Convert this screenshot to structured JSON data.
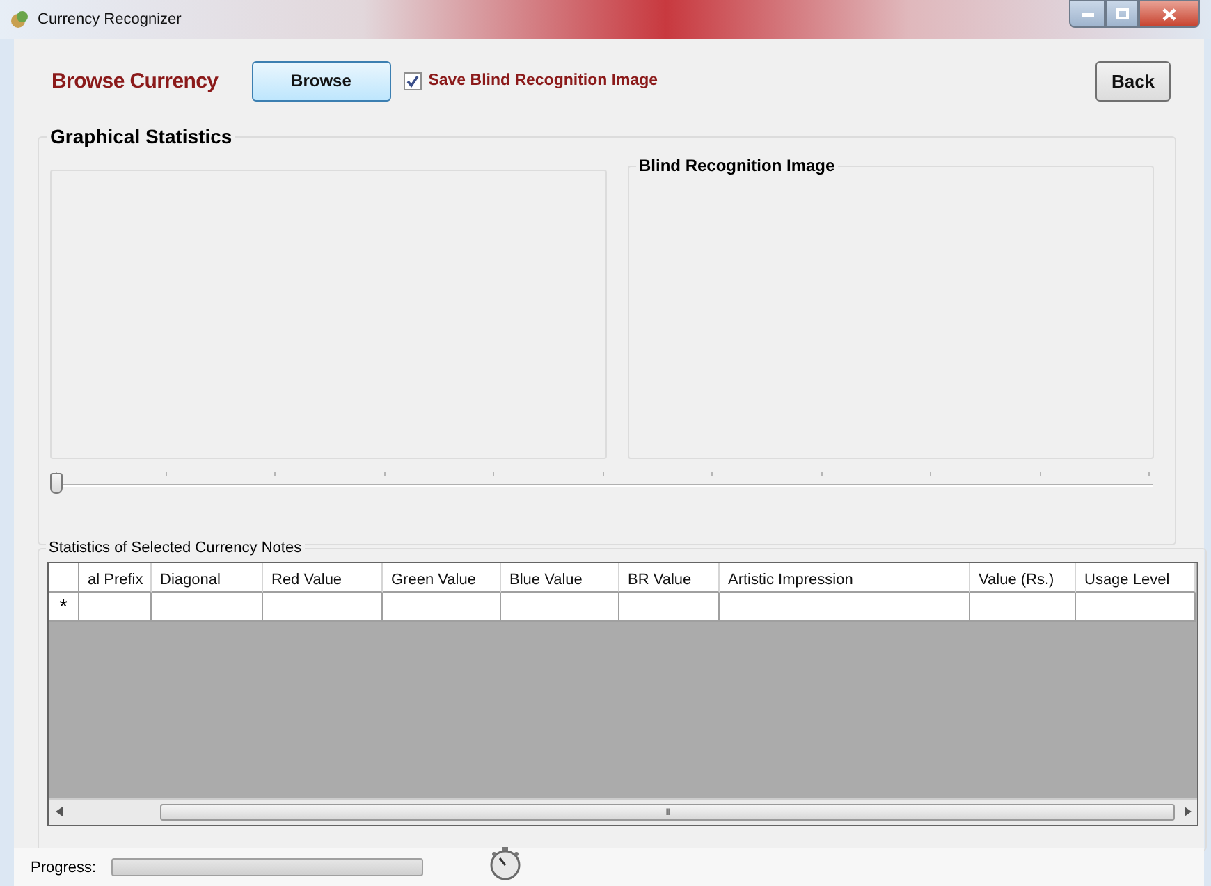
{
  "window": {
    "title": "Currency Recognizer"
  },
  "toolbar": {
    "label": "Browse Currency",
    "browse_button": "Browse",
    "save_checkbox": {
      "label": "Save Blind Recognition Image",
      "checked": true
    },
    "back_button": "Back"
  },
  "graphical_statistics": {
    "title": "Graphical Statistics",
    "image_group": {
      "title": "Blind Recognition Image"
    },
    "slider": {
      "level": 0
    }
  },
  "statistics": {
    "title": "Statistics of Selected Currency Notes",
    "columns": [
      "al Prefix",
      "Diagonal",
      "Red Value",
      "Green Value",
      "Blue Value",
      "BR Value",
      "Artistic Impression",
      "Value (Rs.)",
      "Usage Level"
    ],
    "new_row_marker": "*",
    "scroll_grip": "III"
  },
  "status": {
    "progress_label": "Progress:",
    "progress": {
      "level": 0
    }
  }
}
